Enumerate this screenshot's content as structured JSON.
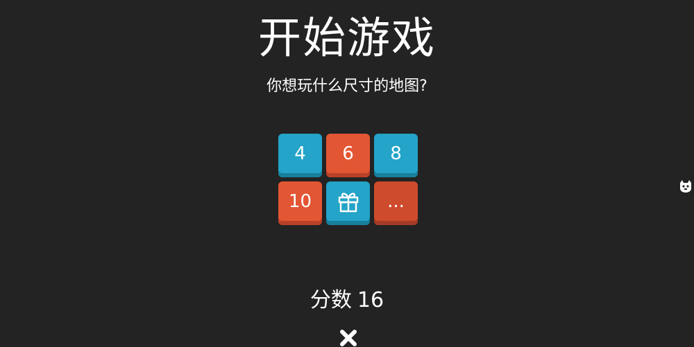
{
  "game": {
    "title": "开始游戏",
    "subtitle": "你想玩什么尺寸的地图?",
    "size_options": [
      {
        "label": "4",
        "color": "#24a4c8",
        "icon": null
      },
      {
        "label": "6",
        "color": "#e35634",
        "icon": null
      },
      {
        "label": "8",
        "color": "#24a4c8",
        "icon": null
      },
      {
        "label": "10",
        "color": "#e35634",
        "icon": null
      },
      {
        "label": "",
        "color": "#24a4c8",
        "icon": "gift-icon"
      },
      {
        "label": "...",
        "color": "#cf4b2d",
        "icon": null
      }
    ],
    "score_label": "分数",
    "score_value": "16",
    "close_icon": "close-icon",
    "side_icon": "cat-icon"
  },
  "colors": {
    "background": "#232323",
    "blue": "#24a4c8",
    "orange": "#e35634",
    "text": "#ffffff"
  }
}
